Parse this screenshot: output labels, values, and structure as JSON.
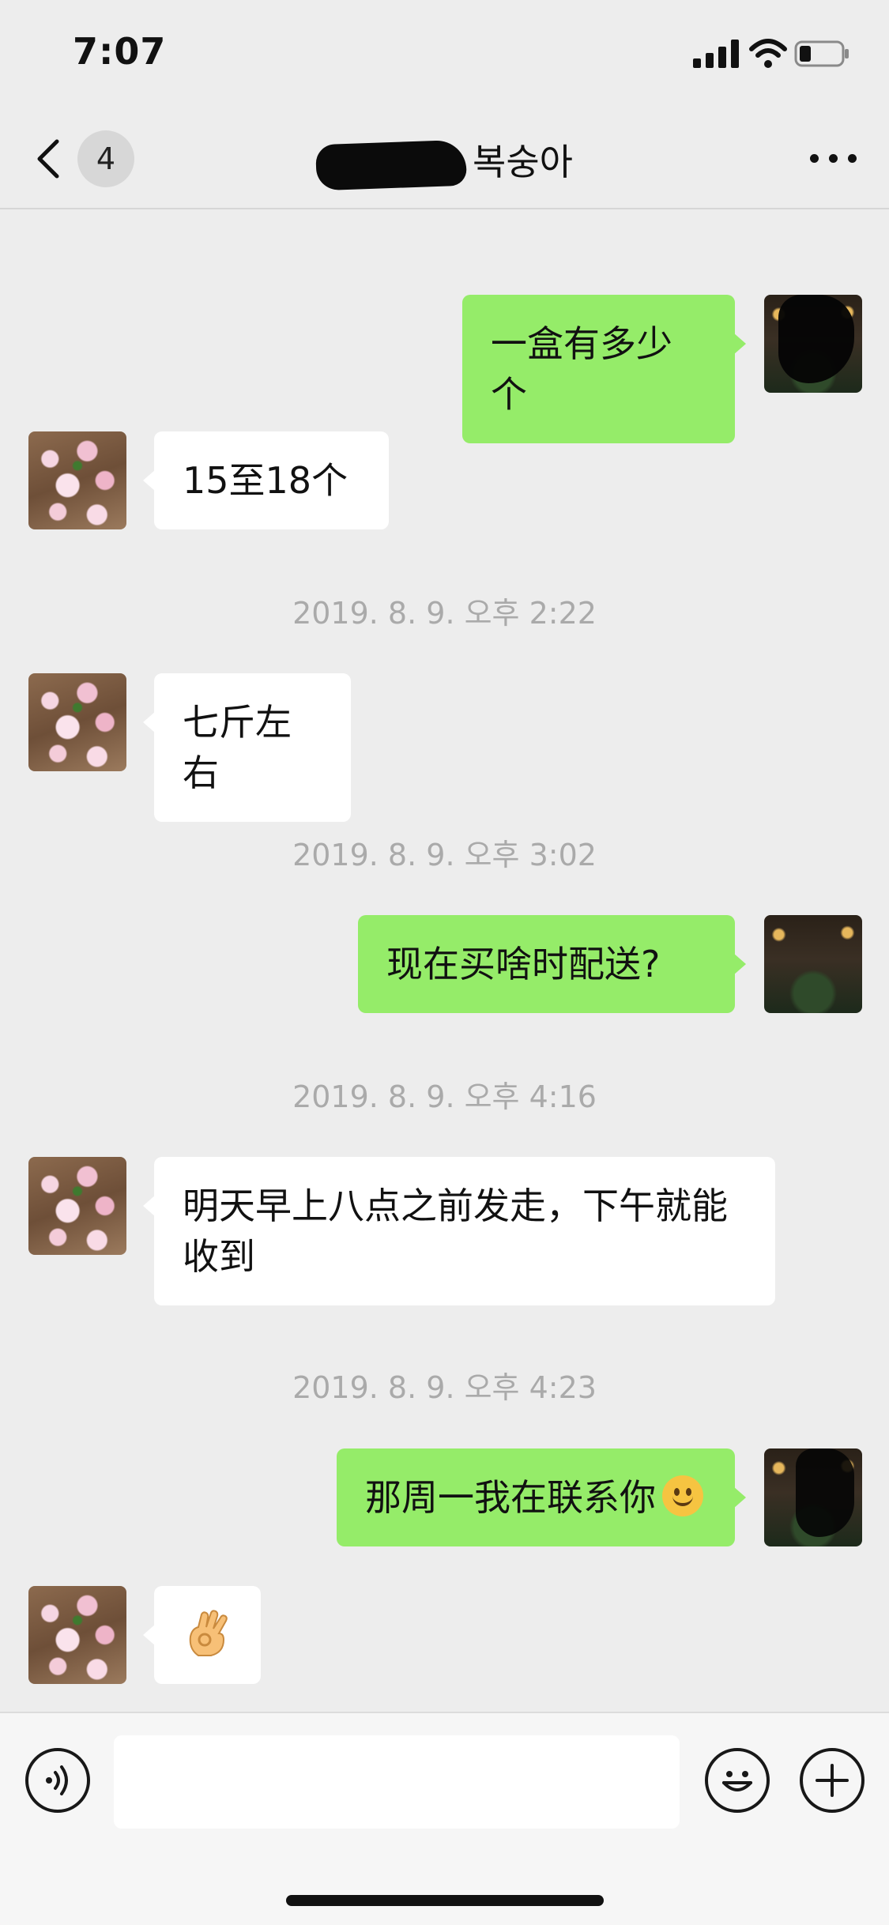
{
  "status_bar": {
    "time": "7:07"
  },
  "nav": {
    "back_badge": "4",
    "title": "복숭아"
  },
  "messages": [
    {
      "side": "out",
      "text": "一盒有多少个"
    },
    {
      "side": "in",
      "text": "15至18个"
    },
    {
      "type": "timestamp",
      "text": "2019. 8. 9. 오후 2:22"
    },
    {
      "side": "in",
      "text": "七斤左右"
    },
    {
      "type": "timestamp",
      "text": "2019. 8. 9. 오후 3:02"
    },
    {
      "side": "out",
      "text": "现在买啥时配送?"
    },
    {
      "type": "timestamp",
      "text": "2019. 8. 9. 오후 4:16"
    },
    {
      "side": "in",
      "text": "明天早上八点之前发走，下午就能收到"
    },
    {
      "type": "timestamp",
      "text": "2019. 8. 9. 오후 4:23"
    },
    {
      "side": "out",
      "text": "那周一我在联系你",
      "emoji": "smile-emoji"
    },
    {
      "side": "in",
      "emoji": "ok-hand-emoji"
    }
  ],
  "input_bar": {
    "voice_icon": "voice-icon",
    "emoji_icon": "emoji-icon",
    "plus_icon": "plus-icon"
  },
  "colors": {
    "background": "#ededed",
    "bubble_out": "#95ec69",
    "bubble_in": "#ffffff",
    "timestamp": "#aaaaaa"
  }
}
